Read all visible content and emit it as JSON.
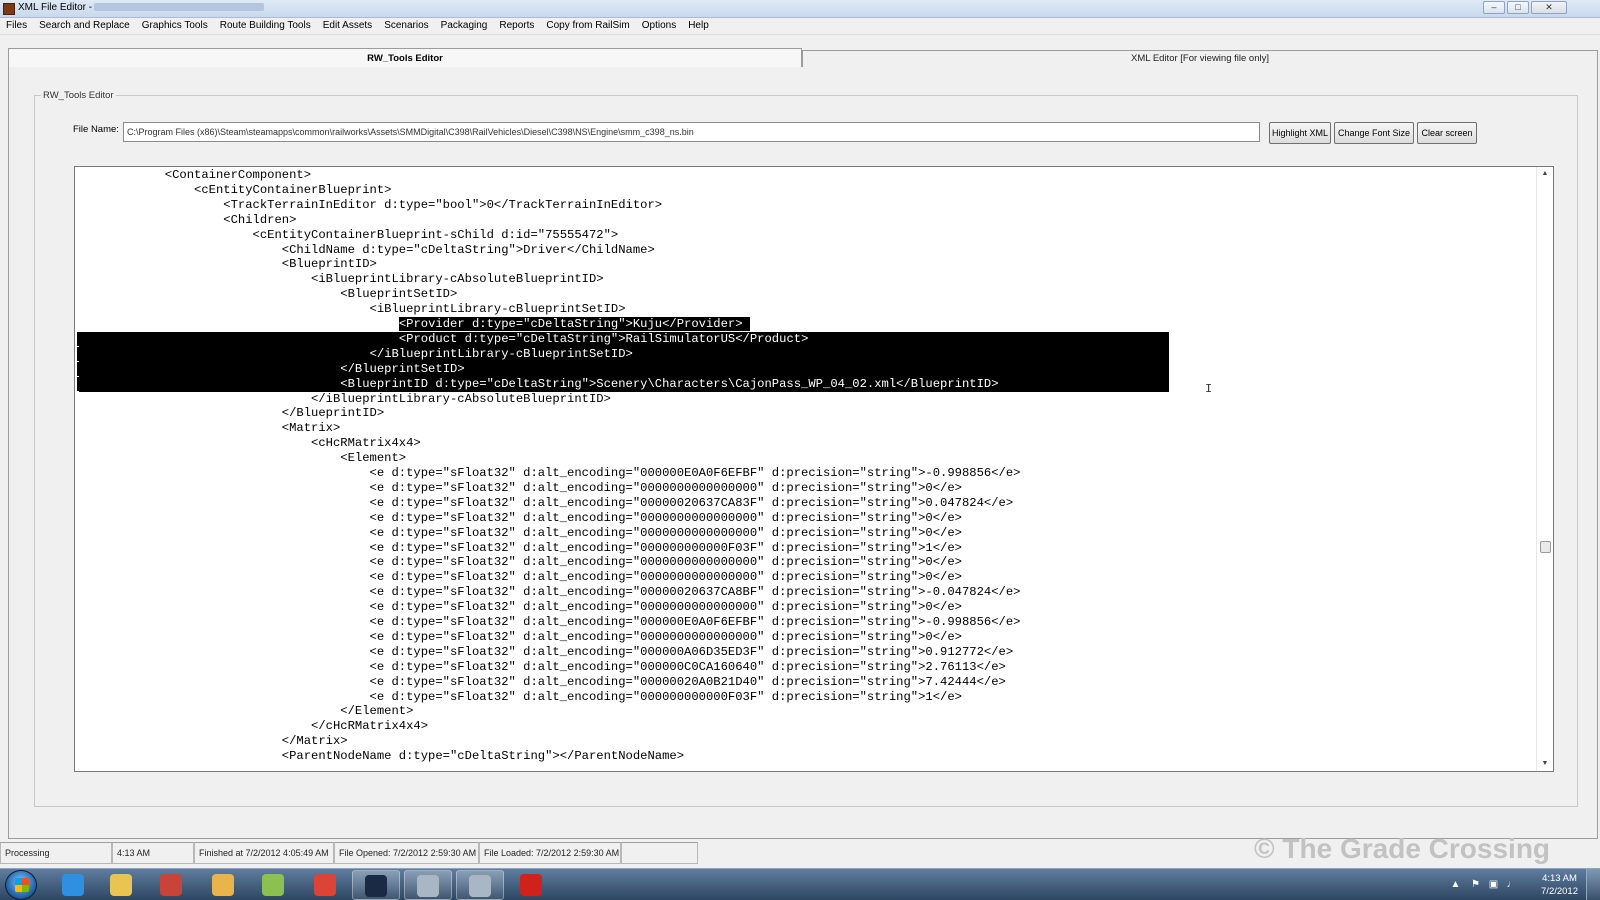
{
  "window": {
    "title": "XML File Editor -",
    "icon": "app-icon",
    "controls": [
      "minimize",
      "maximize",
      "close"
    ]
  },
  "menu": [
    "Files",
    "Search and Replace",
    "Graphics Tools",
    "Route Building Tools",
    "Edit Assets",
    "Scenarios",
    "Packaging",
    "Reports",
    "Copy from RailSim",
    "Options",
    "Help"
  ],
  "tabs": {
    "active": "RW_Tools Editor",
    "inactive": "XML Editor [For viewing file only]"
  },
  "group": {
    "legend": "RW_Tools Editor"
  },
  "file": {
    "label": "File Name:",
    "value": "C:\\Program Files (x86)\\Steam\\steamapps\\common\\railworks\\Assets\\SMMDigital\\C398\\RailVehicles\\Diesel\\C398\\NS\\Engine\\smm_c398_ns.bin"
  },
  "buttons": {
    "highlight": "Highlight XML",
    "font_size": "Change Font Size",
    "clear": "Clear screen"
  },
  "xml_lines": [
    {
      "text": "            <ContainerComponent>"
    },
    {
      "text": "                <cEntityContainerBlueprint>"
    },
    {
      "text": "                    <TrackTerrainInEditor d:type=\"bool\">0</TrackTerrainInEditor>"
    },
    {
      "text": "                    <Children>"
    },
    {
      "text": "                        <cEntityContainerBlueprint-sChild d:id=\"75555472\">"
    },
    {
      "text": "                            <ChildName d:type=\"cDeltaString\">Driver</ChildName>"
    },
    {
      "text": "                            <BlueprintID>"
    },
    {
      "text": "                                <iBlueprintLibrary-cAbsoluteBlueprintID>"
    },
    {
      "text": "                                    <BlueprintSetID>"
    },
    {
      "text": "                                        <iBlueprintLibrary-cBlueprintSetID>"
    },
    {
      "text": "                                            <Provider d:type=\"cDeltaString\">Kuju</Provider>"
    },
    {
      "text": "                                            <Product d:type=\"cDeltaString\">RailSimulatorUS</Product>"
    },
    {
      "text": "                                        </iBlueprintLibrary-cBlueprintSetID>"
    },
    {
      "text": "                                    </BlueprintSetID>"
    },
    {
      "text": "                                    <BlueprintID d:type=\"cDeltaString\">Scenery\\Characters\\CajonPass_WP_04_02.xml</BlueprintID>"
    },
    {
      "text": "                                </iBlueprintLibrary-cAbsoluteBlueprintID>"
    },
    {
      "text": "                            </BlueprintID>"
    },
    {
      "text": "                            <Matrix>"
    },
    {
      "text": "                                <cHcRMatrix4x4>"
    },
    {
      "text": "                                    <Element>"
    },
    {
      "text": "                                        <e d:type=\"sFloat32\" d:alt_encoding=\"000000E0A0F6EFBF\" d:precision=\"string\">-0.998856</e>"
    },
    {
      "text": "                                        <e d:type=\"sFloat32\" d:alt_encoding=\"0000000000000000\" d:precision=\"string\">0</e>"
    },
    {
      "text": "                                        <e d:type=\"sFloat32\" d:alt_encoding=\"00000020637CA83F\" d:precision=\"string\">0.047824</e>"
    },
    {
      "text": "                                        <e d:type=\"sFloat32\" d:alt_encoding=\"0000000000000000\" d:precision=\"string\">0</e>"
    },
    {
      "text": "                                        <e d:type=\"sFloat32\" d:alt_encoding=\"0000000000000000\" d:precision=\"string\">0</e>"
    },
    {
      "text": "                                        <e d:type=\"sFloat32\" d:alt_encoding=\"000000000000F03F\" d:precision=\"string\">1</e>"
    },
    {
      "text": "                                        <e d:type=\"sFloat32\" d:alt_encoding=\"0000000000000000\" d:precision=\"string\">0</e>"
    },
    {
      "text": "                                        <e d:type=\"sFloat32\" d:alt_encoding=\"0000000000000000\" d:precision=\"string\">0</e>"
    },
    {
      "text": "                                        <e d:type=\"sFloat32\" d:alt_encoding=\"00000020637CA8BF\" d:precision=\"string\">-0.047824</e>"
    },
    {
      "text": "                                        <e d:type=\"sFloat32\" d:alt_encoding=\"0000000000000000\" d:precision=\"string\">0</e>"
    },
    {
      "text": "                                        <e d:type=\"sFloat32\" d:alt_encoding=\"000000E0A0F6EFBF\" d:precision=\"string\">-0.998856</e>"
    },
    {
      "text": "                                        <e d:type=\"sFloat32\" d:alt_encoding=\"0000000000000000\" d:precision=\"string\">0</e>"
    },
    {
      "text": "                                        <e d:type=\"sFloat32\" d:alt_encoding=\"000000A06D35ED3F\" d:precision=\"string\">0.912772</e>"
    },
    {
      "text": "                                        <e d:type=\"sFloat32\" d:alt_encoding=\"000000C0CA160640\" d:precision=\"string\">2.76113</e>"
    },
    {
      "text": "                                        <e d:type=\"sFloat32\" d:alt_encoding=\"00000020A0B21D40\" d:precision=\"string\">7.42444</e>"
    },
    {
      "text": "                                        <e d:type=\"sFloat32\" d:alt_encoding=\"000000000000F03F\" d:precision=\"string\">1</e>"
    },
    {
      "text": "                                    </Element>"
    },
    {
      "text": "                                </cHcRMatrix4x4>"
    },
    {
      "text": "                            </Matrix>"
    },
    {
      "text": "                            <ParentNodeName d:type=\"cDeltaString\"></ParentNodeName>"
    }
  ],
  "selection": {
    "first_line": 10,
    "last_line": 14
  },
  "status": {
    "state": "Processing",
    "time": "4:13 AM",
    "finished": "Finished at 7/2/2012 4:05:49 AM",
    "opened": "File Opened: 7/2/2012 2:59:30 AM",
    "loaded": "File Loaded: 7/2/2012 2:59:30 AM"
  },
  "watermark": "© The Grade Crossing",
  "taskbar": {
    "apps": [
      {
        "icon": "internet-explorer-icon",
        "color": "#2f8fe0",
        "open": false
      },
      {
        "icon": "file-explorer-icon",
        "color": "#e8c453",
        "open": false
      },
      {
        "icon": "package-icon",
        "color": "#c8443a",
        "open": false
      },
      {
        "icon": "contacts-icon",
        "color": "#e9b44c",
        "open": false
      },
      {
        "icon": "notepad-icon",
        "color": "#8cc152",
        "open": false
      },
      {
        "icon": "chrome-icon",
        "color": "#db4437",
        "open": false
      },
      {
        "icon": "train-sim-icon",
        "color": "#1b2a44",
        "open": true
      },
      {
        "icon": "globe-app-icon",
        "color": "#a9b6c4",
        "open": true
      },
      {
        "icon": "globe-app-icon",
        "color": "#a9b6c4",
        "open": true
      },
      {
        "icon": "splat-tool-icon",
        "color": "#d0221c",
        "open": false
      }
    ],
    "clock_time": "4:13 AM",
    "clock_date": "7/2/2012"
  }
}
